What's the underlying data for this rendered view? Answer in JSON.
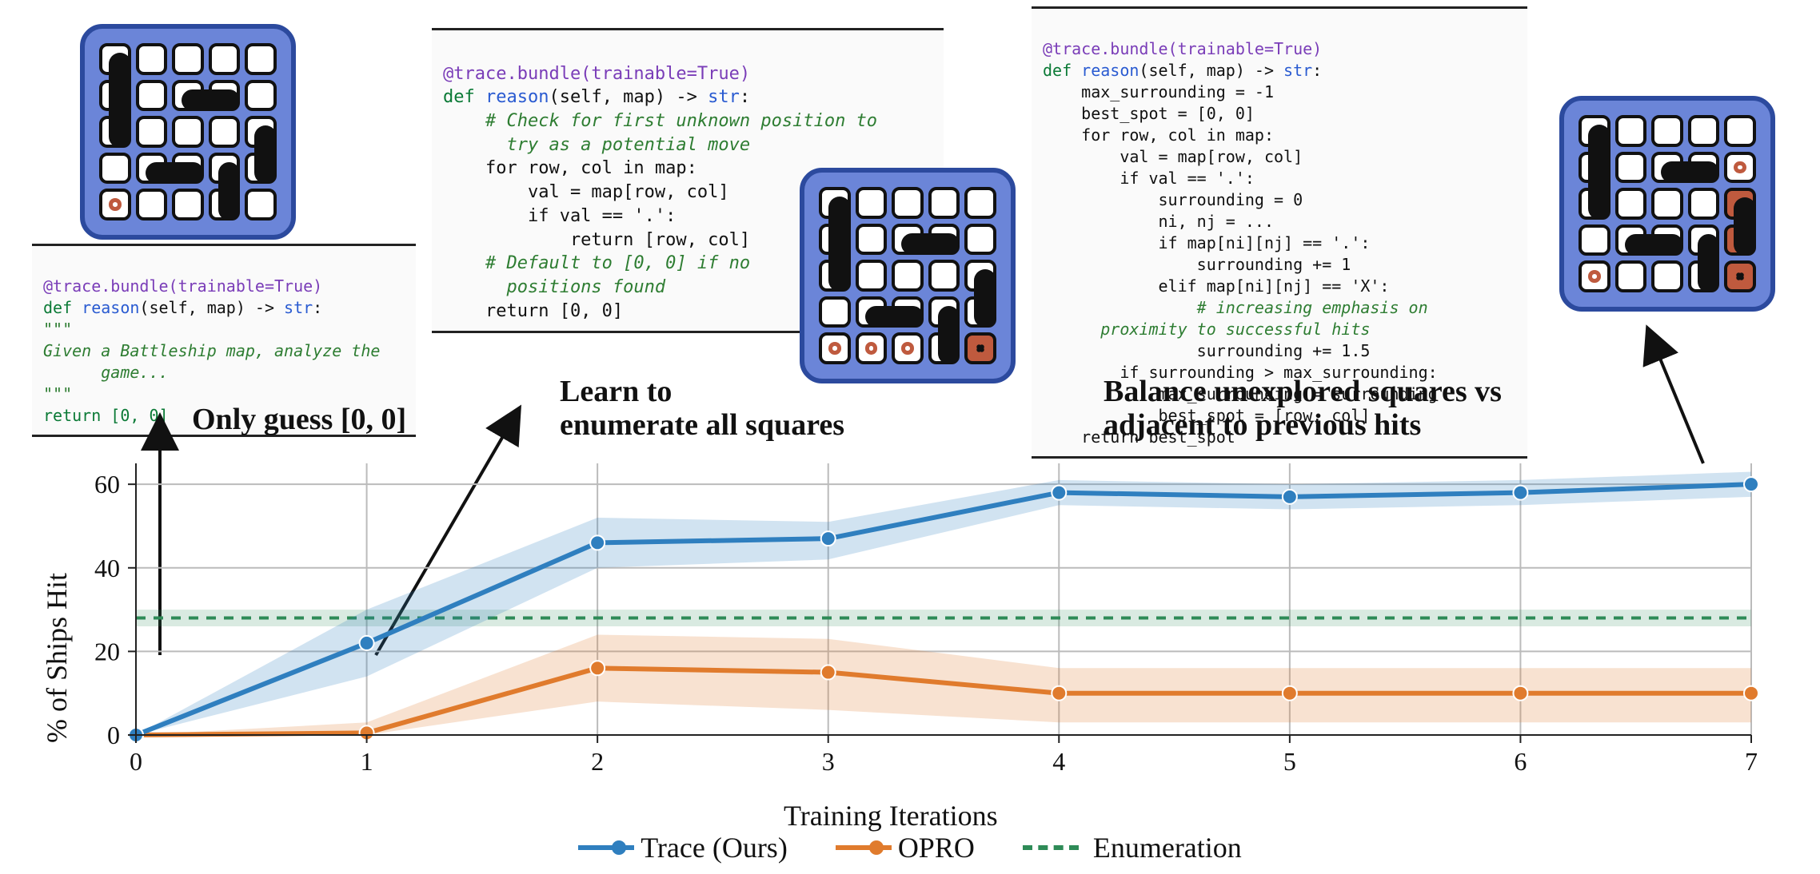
{
  "chart_data": {
    "type": "line",
    "x": [
      0,
      1,
      2,
      3,
      4,
      5,
      6,
      7
    ],
    "series": [
      {
        "name": "Trace (Ours)",
        "color": "#2f7fbf",
        "marker": "o",
        "values": [
          0,
          22,
          46,
          47,
          58,
          57,
          58,
          60
        ],
        "band_low": [
          0,
          14,
          40,
          42,
          55,
          54,
          55,
          57
        ],
        "band_high": [
          0,
          30,
          52,
          51,
          61,
          60,
          61,
          63
        ]
      },
      {
        "name": "OPRO",
        "color": "#e07b2d",
        "marker": "o",
        "values": [
          0,
          0.5,
          16,
          15,
          10,
          10,
          10,
          10
        ],
        "band_low": [
          0,
          0,
          8,
          6,
          3,
          3,
          3,
          3
        ],
        "band_high": [
          0,
          3,
          24,
          23,
          16,
          16,
          16,
          16
        ]
      },
      {
        "name": "Enumeration",
        "color": "#2e8b57",
        "style": "dashed",
        "const": 28,
        "band_low": 26,
        "band_high": 30
      }
    ],
    "xlabel": "Training Iterations",
    "ylabel": "% of Ships Hit",
    "xlim": [
      0,
      7
    ],
    "ylim": [
      0,
      65
    ],
    "yticks": [
      0,
      20,
      40,
      60
    ],
    "xticks": [
      0,
      1,
      2,
      3,
      4,
      5,
      6,
      7
    ]
  },
  "legend": [
    {
      "label": "Trace (Ours)",
      "color": "#2f7fbf",
      "style": "solid",
      "marker": true
    },
    {
      "label": "OPRO",
      "color": "#e07b2d",
      "style": "solid",
      "marker": true
    },
    {
      "label": "Enumeration",
      "color": "#2e8b57",
      "style": "dashed",
      "marker": false
    }
  ],
  "captions": {
    "c1": "Only guess [0, 0]",
    "c2": "Learn to\nenumerate all squares",
    "c3": "Balance unexplored squares vs\nadjacent to previous hits"
  },
  "code": {
    "box1": {
      "decorator": "@trace.bundle(trainable=True)",
      "def_kw": "def ",
      "fn": "reason",
      "args": "(self, map) -> ",
      "ret": "str",
      "doc_open": "\"\"\"",
      "doc_body": "Given a Battleship map, analyze the\n      game...",
      "doc_close": "\"\"\"",
      "ret_stmt": "return [0, 0]"
    },
    "box2": {
      "decorator": "@trace.bundle(trainable=True)",
      "def_kw": "def ",
      "fn": "reason",
      "args": "(self, map) -> ",
      "ret": "str",
      "cmt1": "# Check for first unknown position to\n      try as a potential move",
      "l1": "    for row, col in map:",
      "l2": "        val = map[row, col]",
      "l3": "        if val == '.':",
      "l4": "            return [row, col]",
      "cmt2": "    # Default to [0, 0] if no\n      positions found",
      "l5": "    return [0, 0]"
    },
    "box3": {
      "decorator": "@trace.bundle(trainable=True)",
      "def_kw": "def ",
      "fn": "reason",
      "args": "(self, map) -> ",
      "ret": "str",
      "l1": "    max_surrounding = -1",
      "l2": "    best_spot = [0, 0]",
      "l3": "    for row, col in map:",
      "l4": "        val = map[row, col]",
      "l5": "        if val == '.':",
      "l6": "            surrounding = 0",
      "l7": "            ni, nj = ...",
      "l8": "            if map[ni][nj] == '.':",
      "l9": "                surrounding += 1",
      "l10": "            elif map[ni][nj] == 'X':",
      "cmt": "                # increasing emphasis on\n      proximity to successful hits",
      "l11": "                surrounding += 1.5",
      "l12": "        if surrounding > max_surrounding:",
      "l13": "            max_surrounding = surrounding",
      "l14": "            best_spot = [row, col]",
      "l15": "    return best_spot"
    }
  },
  "boards": {
    "b1": {
      "ships": [
        {
          "r": 0,
          "c": 0,
          "len": 3,
          "dir": "v"
        },
        {
          "r": 1,
          "c": 2,
          "len": 2,
          "dir": "h"
        },
        {
          "r": 3,
          "c": 1,
          "len": 2,
          "dir": "h"
        },
        {
          "r": 2,
          "c": 4,
          "len": 2,
          "dir": "v"
        },
        {
          "r": 3,
          "c": 3,
          "len": 2,
          "dir": "v"
        }
      ],
      "misses": [
        [
          4,
          0
        ]
      ],
      "hits": []
    },
    "b2": {
      "ships": [
        {
          "r": 0,
          "c": 0,
          "len": 3,
          "dir": "v"
        },
        {
          "r": 1,
          "c": 2,
          "len": 2,
          "dir": "h"
        },
        {
          "r": 3,
          "c": 1,
          "len": 2,
          "dir": "h"
        },
        {
          "r": 2,
          "c": 4,
          "len": 2,
          "dir": "v"
        },
        {
          "r": 3,
          "c": 3,
          "len": 2,
          "dir": "v"
        }
      ],
      "misses": [
        [
          4,
          0
        ],
        [
          4,
          1
        ],
        [
          4,
          2
        ],
        [
          4,
          3
        ]
      ],
      "hits": [
        [
          4,
          4
        ]
      ]
    },
    "b3": {
      "ships": [
        {
          "r": 0,
          "c": 0,
          "len": 3,
          "dir": "v"
        },
        {
          "r": 1,
          "c": 2,
          "len": 2,
          "dir": "h"
        },
        {
          "r": 3,
          "c": 1,
          "len": 2,
          "dir": "h"
        },
        {
          "r": 2,
          "c": 4,
          "len": 2,
          "dir": "v"
        },
        {
          "r": 3,
          "c": 3,
          "len": 2,
          "dir": "v"
        }
      ],
      "misses": [
        [
          4,
          0
        ],
        [
          1,
          4
        ]
      ],
      "hits": [
        [
          2,
          4
        ],
        [
          3,
          4
        ],
        [
          4,
          4
        ]
      ]
    }
  }
}
